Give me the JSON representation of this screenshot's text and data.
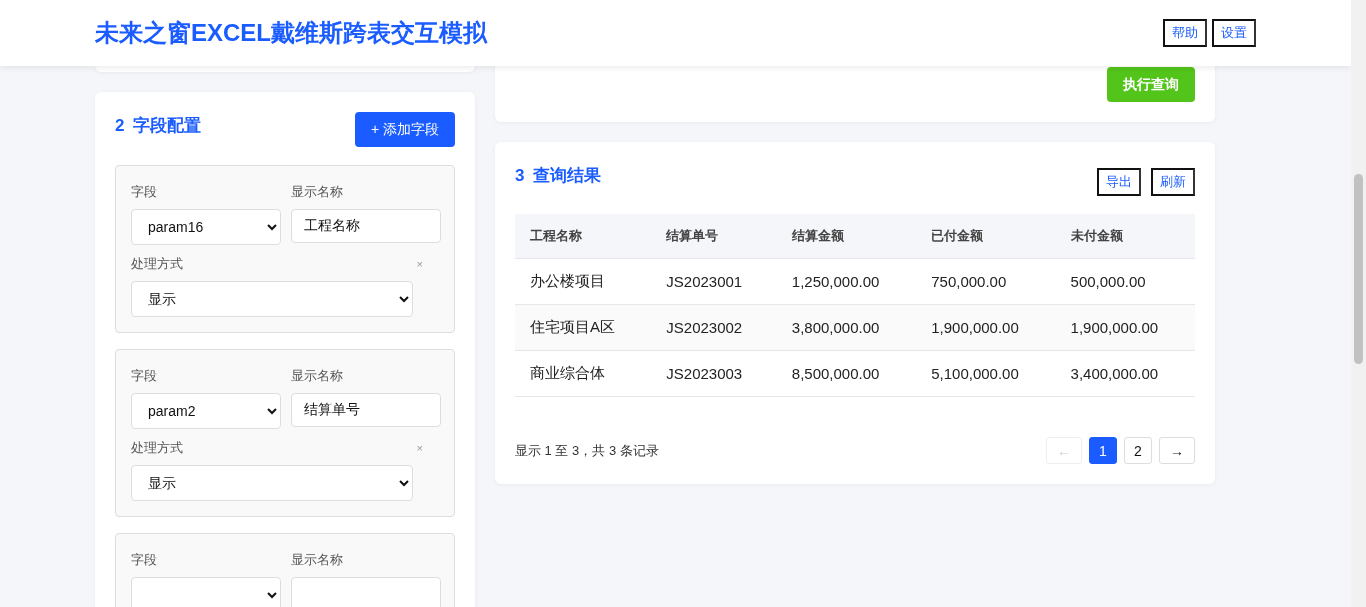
{
  "header": {
    "title": "未来之窗EXCEL戴维斯跨表交互模拟",
    "buttons": [
      "帮助",
      "设置"
    ]
  },
  "query_card": {
    "button": "执行查询"
  },
  "field_config": {
    "number": "2",
    "title": "字段配置",
    "add_button": "+ 添加字段",
    "items": [
      {
        "field_label": "字段",
        "field_value": "param16",
        "name_label": "显示名称",
        "name_value": "工程名称",
        "mode_label": "处理方式",
        "mode_value": "显示",
        "remove": "×"
      },
      {
        "field_label": "字段",
        "field_value": "param2",
        "name_label": "显示名称",
        "name_value": "结算单号",
        "mode_label": "处理方式",
        "mode_value": "显示",
        "remove": "×"
      },
      {
        "field_label": "字段",
        "name_label": "显示名称"
      }
    ]
  },
  "results": {
    "number": "3",
    "title": "查询结果",
    "buttons": [
      "导出",
      "刷新"
    ],
    "table": {
      "columns": [
        "工程名称",
        "结算单号",
        "结算金额",
        "已付金额",
        "未付金额"
      ],
      "rows": [
        [
          "办公楼项目",
          "JS2023001",
          "1,250,000.00",
          "750,000.00",
          "500,000.00"
        ],
        [
          "住宅项目A区",
          "JS2023002",
          "3,800,000.00",
          "1,900,000.00",
          "1,900,000.00"
        ],
        [
          "商业综合体",
          "JS2023003",
          "8,500,000.00",
          "5,100,000.00",
          "3,400,000.00"
        ]
      ]
    },
    "summary": "显示 1 至 3，共 3 条记录",
    "pagination": [
      {
        "kind": "prev",
        "label": "←",
        "disabled": true,
        "selected": false
      },
      {
        "kind": "page",
        "label": "1",
        "disabled": false,
        "selected": true
      },
      {
        "kind": "page",
        "label": "2",
        "disabled": false,
        "selected": false
      },
      {
        "kind": "next",
        "label": "→",
        "disabled": false,
        "selected": false
      }
    ]
  }
}
